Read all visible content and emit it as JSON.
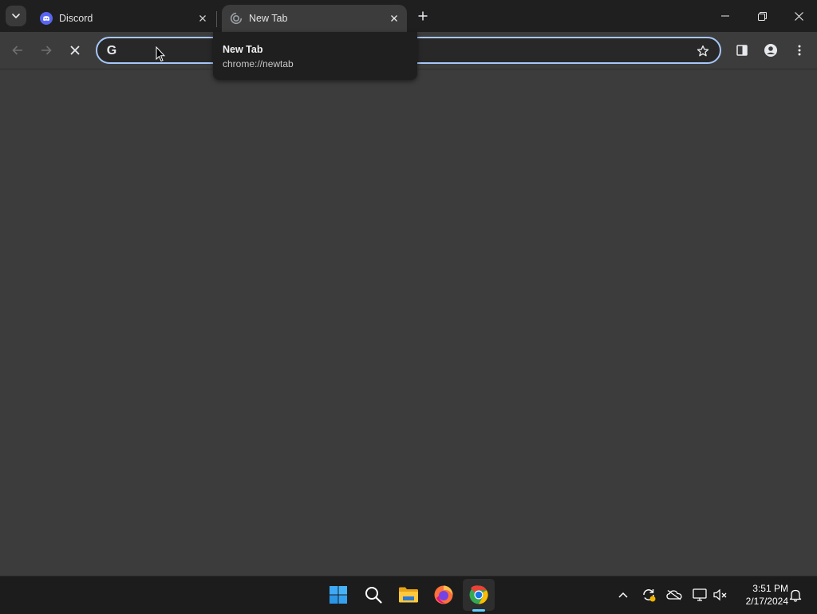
{
  "tabs": [
    {
      "title": "Discord",
      "icon": "discord-icon",
      "active": false
    },
    {
      "title": "New Tab",
      "icon": "chrome-loading-icon",
      "active": true
    }
  ],
  "omnibox": {
    "value": "",
    "placeholder": ""
  },
  "hover_card": {
    "title": "New Tab",
    "url": "chrome://newtab"
  },
  "taskbar": {
    "apps": [
      "start-icon",
      "search-icon",
      "file-explorer-icon",
      "firefox-icon",
      "chrome-icon"
    ],
    "active_app": "chrome-icon",
    "time": "3:51 PM",
    "date": "2/17/2024"
  },
  "colors": {
    "tabstrip": "#1f1f1f",
    "toolbar": "#3c3c3c",
    "omnibox_focus": "#a8c7fa",
    "discord": "#5865f2",
    "taskbar": "#1c1c1c"
  }
}
